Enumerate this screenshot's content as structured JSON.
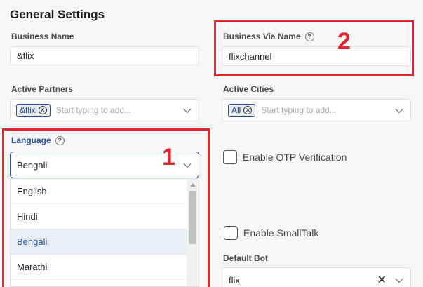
{
  "page": {
    "title": "General Settings"
  },
  "business_name": {
    "label": "Business Name",
    "value": "&flix"
  },
  "business_via_name": {
    "label": "Business Via Name",
    "value": "flixchannel",
    "help_icon": "?"
  },
  "active_partners": {
    "label": "Active Partners",
    "chip": "&flix",
    "placeholder": "Start typing to add..."
  },
  "active_cities": {
    "label": "Active Cities",
    "chip": "All",
    "placeholder": "Start typing to add..."
  },
  "language": {
    "label": "Language",
    "help_icon": "?",
    "selected": "Bengali",
    "options": [
      "English",
      "Hindi",
      "Bengali",
      "Marathi"
    ]
  },
  "enable_otp": {
    "label": "Enable OTP Verification",
    "checked": false
  },
  "enable_smalltalk": {
    "label": "Enable SmallTalk",
    "checked": false
  },
  "default_bot": {
    "label": "Default Bot",
    "value": "flix",
    "clear_icon": "✕"
  },
  "annotations": {
    "box1_number": "1",
    "box2_number": "2",
    "color": "#e3242b"
  },
  "colors": {
    "accent": "#2752a6",
    "selected_bg": "#e9eef7"
  },
  "icons": {
    "chip_remove": "✕",
    "help": "?"
  }
}
